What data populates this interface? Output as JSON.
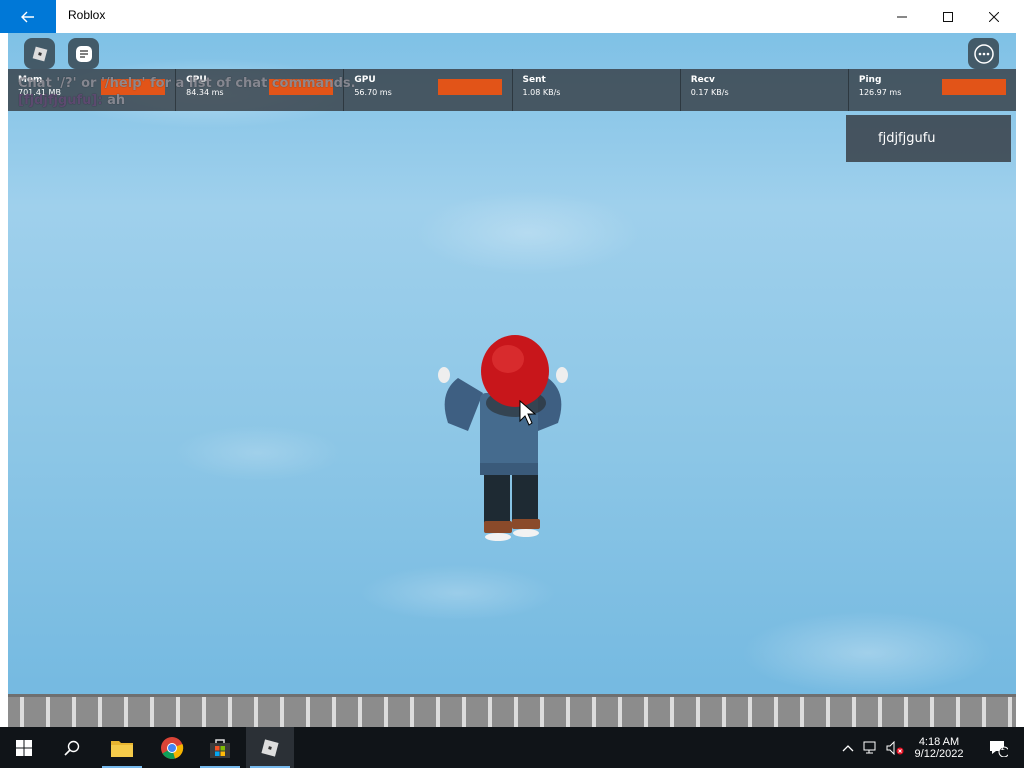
{
  "window": {
    "title": "Roblox",
    "back_icon": "back-arrow-icon",
    "minimize_icon": "minimize-icon",
    "maximize_icon": "maximize-icon",
    "close_icon": "close-icon"
  },
  "stats": [
    {
      "label": "Mem",
      "value": "701.41 MB"
    },
    {
      "label": "CPU",
      "value": "84.34 ms"
    },
    {
      "label": "GPU",
      "value": "56.70 ms"
    },
    {
      "label": "Sent",
      "value": "1.08 KB/s"
    },
    {
      "label": "Recv",
      "value": "0.17 KB/s"
    },
    {
      "label": "Ping",
      "value": "126.97 ms"
    }
  ],
  "chat": {
    "hint": "Chat '/?' or '/help' for a list of chat commands.",
    "username": "[fjdjfjgufu]:",
    "message": "ah"
  },
  "player_list": {
    "player": "fjdjfjgufu"
  },
  "taskbar": {
    "time": "4:18 AM",
    "date": "9/12/2022",
    "notification_count": "1"
  },
  "colors": {
    "accent": "#0078d7",
    "stat_bar": "#e25418",
    "sky": "#8cc6e6"
  }
}
